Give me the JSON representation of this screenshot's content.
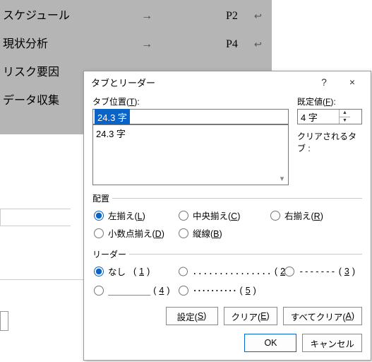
{
  "document": {
    "lines": [
      {
        "label": "スケジュール",
        "arrow": "→",
        "page": "P2",
        "mark": "↩"
      },
      {
        "label": "現状分析",
        "arrow": "→",
        "page": "P4",
        "mark": "↩"
      },
      {
        "label": "リスク要因",
        "arrow": "",
        "page": "",
        "mark": ""
      },
      {
        "label": "データ収集",
        "arrow": "",
        "page": "",
        "mark": ""
      }
    ]
  },
  "dialog": {
    "title": "タブとリーダー",
    "help_tooltip": "?",
    "close_tooltip": "×",
    "tab_pos_label": "タブ位置(",
    "tab_pos_key": "T",
    "tab_pos_label_tail": "):",
    "tab_pos_value": "24.3 字",
    "list_items": [
      "24.3 字"
    ],
    "default_label": "既定値(",
    "default_key": "F",
    "default_label_tail": "):",
    "default_value": "4 字",
    "cleared_label": "クリアされるタブ :",
    "group_align": "配置",
    "align": {
      "left": {
        "text": "左揃え(",
        "key": "L",
        "tail": ")"
      },
      "center": {
        "text": "中央揃え(",
        "key": "C",
        "tail": ")"
      },
      "right": {
        "text": "右揃え(",
        "key": "R",
        "tail": ")"
      },
      "decimal": {
        "text": "小数点揃え(",
        "key": "D",
        "tail": ")"
      },
      "bar": {
        "text": "縦線(",
        "key": "B",
        "tail": ")"
      }
    },
    "group_leader": "リーダー",
    "leader": {
      "none": {
        "text": "なし",
        "key": "1"
      },
      "dots": {
        "vis": "...............",
        "key": "2"
      },
      "dashes": {
        "vis": "-------",
        "key": "3"
      },
      "under": {
        "vis": "________",
        "key": "4"
      },
      "middot": {
        "vis": "･･････････",
        "key": "5"
      }
    },
    "btn_set": {
      "text": "設定(",
      "key": "S",
      "tail": ")"
    },
    "btn_clear": {
      "text": "クリア(",
      "key": "E",
      "tail": ")"
    },
    "btn_clearall": {
      "text": "すべてクリア(",
      "key": "A",
      "tail": ")"
    },
    "btn_ok": "OK",
    "btn_cancel": "キャンセル"
  }
}
